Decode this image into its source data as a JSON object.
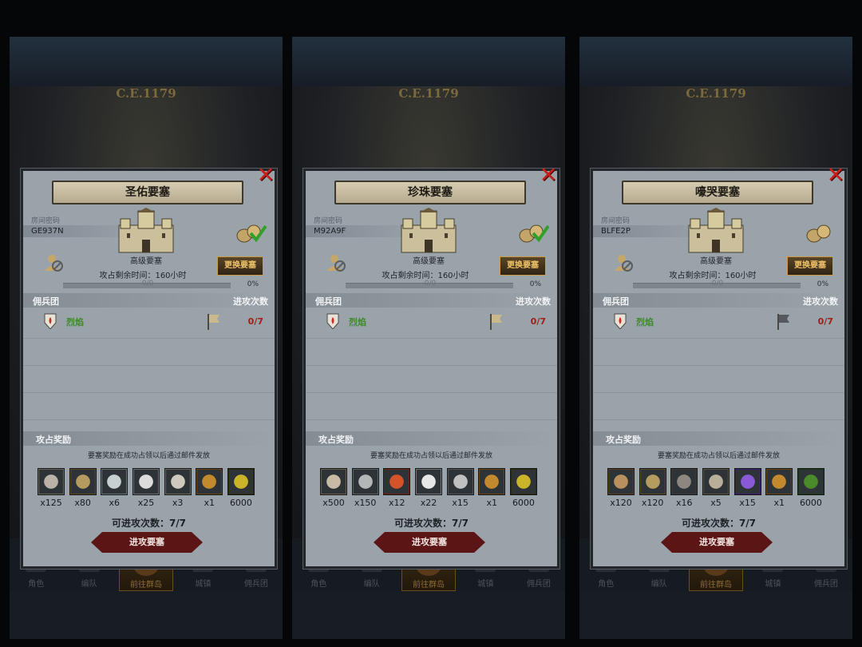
{
  "panels": [
    {
      "era": "C.E.1179",
      "title": "圣佑要塞",
      "room_label": "房间密码",
      "room_code": "GE937N",
      "fortress_type": "高级要塞",
      "change_button": "更换要塞",
      "time_text": "攻占剩余时间：160小时",
      "progress_count": "0/0",
      "progress_percent": "0%",
      "progress_fraction": 0,
      "mercenary_label": "佣兵团",
      "attacks_label": "进攻次数",
      "mercenary": {
        "name": "烈焰",
        "count": "0/7"
      },
      "loot_claimed": true,
      "reward_label": "攻占奖励",
      "reward_note": "要塞奖励在成功占领以后通过邮件发放",
      "rewards": [
        {
          "icon": "shell-pile-icon",
          "qty": "x125"
        },
        {
          "icon": "goblet-icon",
          "qty": "x80"
        },
        {
          "icon": "stone-icon",
          "qty": "x6"
        },
        {
          "icon": "pearls-icon",
          "qty": "x25"
        },
        {
          "icon": "ore-pile-icon",
          "qty": "x3"
        },
        {
          "icon": "gold-coin-icon",
          "qty": "x1"
        },
        {
          "icon": "banner-icon",
          "qty": "6000"
        }
      ],
      "attempts": "可进攻次数：7/7",
      "attack_button": "进攻要塞",
      "nav": [
        "角色",
        "编队",
        "前往群岛",
        "城镇",
        "佣兵团"
      ]
    },
    {
      "era": "C.E.1179",
      "title": "珍珠要塞",
      "room_label": "房间密码",
      "room_code": "M92A9F",
      "fortress_type": "高级要塞",
      "change_button": "更换要塞",
      "time_text": "攻占剩余时间：160小时",
      "progress_count": "0/0",
      "progress_percent": "0%",
      "progress_fraction": 0,
      "mercenary_label": "佣兵团",
      "attacks_label": "进攻次数",
      "mercenary": {
        "name": "烈焰",
        "count": "0/7"
      },
      "loot_claimed": true,
      "reward_label": "攻占奖励",
      "reward_note": "要塞奖励在成功占领以后通过邮件发放",
      "rewards": [
        {
          "icon": "sand-pile-icon",
          "qty": "x500"
        },
        {
          "icon": "oyster-icon",
          "qty": "x150"
        },
        {
          "icon": "roe-icon",
          "qty": "x12"
        },
        {
          "icon": "pearl-icon",
          "qty": "x22"
        },
        {
          "icon": "wings-icon",
          "qty": "x15"
        },
        {
          "icon": "gold-coin-icon",
          "qty": "x1"
        },
        {
          "icon": "banner-icon",
          "qty": "6000"
        }
      ],
      "attempts": "可进攻次数：7/7",
      "attack_button": "进攻要塞",
      "nav": [
        "角色",
        "编队",
        "前往群岛",
        "城镇",
        "佣兵团"
      ]
    },
    {
      "era": "C.E.1179",
      "title": "嚎哭要塞",
      "room_label": "房间密码",
      "room_code": "BLFE2P",
      "fortress_type": "高级要塞",
      "change_button": "更换要塞",
      "time_text": "攻占剩余时间：160小时",
      "progress_count": "0/0",
      "progress_percent": "0%",
      "progress_fraction": 0,
      "mercenary_label": "佣兵团",
      "attacks_label": "进攻次数",
      "mercenary": {
        "name": "烈焰",
        "count": "0/7"
      },
      "loot_claimed": false,
      "reward_label": "攻占奖励",
      "reward_note": "要塞奖励在成功占领以后通过邮件发放",
      "rewards": [
        {
          "icon": "pouch-icon",
          "qty": "x120"
        },
        {
          "icon": "goblet-icon",
          "qty": "x120"
        },
        {
          "icon": "rock-icon",
          "qty": "x16"
        },
        {
          "icon": "horn-icon",
          "qty": "x5"
        },
        {
          "icon": "purple-gem-icon",
          "qty": "x15"
        },
        {
          "icon": "gold-coin-icon",
          "qty": "x1"
        },
        {
          "icon": "tree-banner-icon",
          "qty": "6000"
        }
      ],
      "attempts": "可进攻次数：7/7",
      "attack_button": "进攻要塞",
      "nav": [
        "角色",
        "编队",
        "前往群岛",
        "城镇",
        "佣兵团"
      ]
    }
  ]
}
